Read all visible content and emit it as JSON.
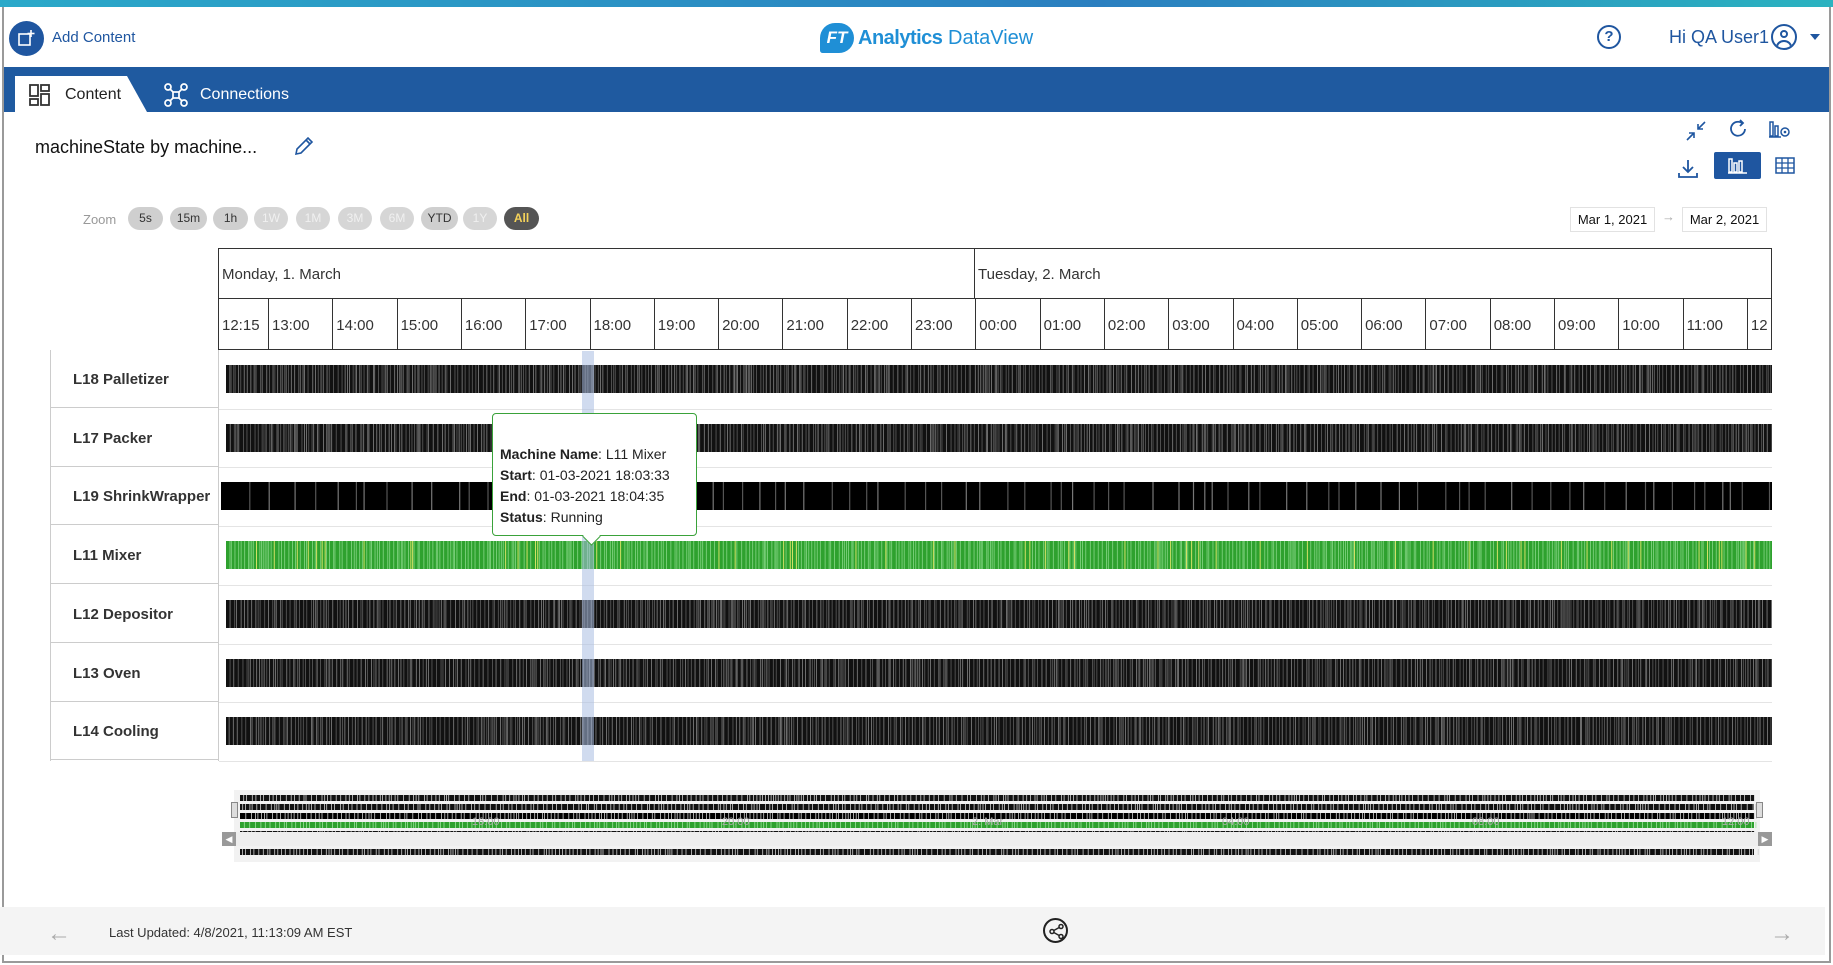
{
  "header": {
    "add_content_label": "Add Content",
    "logo_brand": "FT",
    "logo_product": "Analytics",
    "logo_suffix": "DataView",
    "greeting": "Hi QA User1",
    "icons": [
      "add-content-icon",
      "help-icon",
      "user-icon",
      "chevron-down-icon"
    ]
  },
  "nav": {
    "tabs": [
      {
        "label": "Content",
        "active": true,
        "icon": "grid-icon"
      },
      {
        "label": "Connections",
        "active": false,
        "icon": "connections-icon"
      }
    ]
  },
  "visualization": {
    "title": "machineState by machine...",
    "toolbar_icons": [
      "collapse-icon",
      "refresh-icon",
      "chart-settings-icon",
      "download-icon",
      "chart-view-icon",
      "table-view-icon"
    ]
  },
  "zoom": {
    "label": "Zoom",
    "options": [
      {
        "label": "5s",
        "enabled": true,
        "selected": false
      },
      {
        "label": "15m",
        "enabled": true,
        "selected": false
      },
      {
        "label": "1h",
        "enabled": true,
        "selected": false
      },
      {
        "label": "1W",
        "enabled": false,
        "selected": false
      },
      {
        "label": "1M",
        "enabled": false,
        "selected": false
      },
      {
        "label": "3M",
        "enabled": false,
        "selected": false
      },
      {
        "label": "6M",
        "enabled": false,
        "selected": false
      },
      {
        "label": "YTD",
        "enabled": true,
        "selected": false
      },
      {
        "label": "1Y",
        "enabled": false,
        "selected": false
      },
      {
        "label": "All",
        "enabled": true,
        "selected": true
      }
    ],
    "range_from": "Mar 1, 2021",
    "range_separator": "→",
    "range_to": "Mar 2, 2021"
  },
  "chart_data": {
    "type": "timeline",
    "days": [
      "Monday, 1. March",
      "Tuesday, 2. March"
    ],
    "hours": [
      "12:15",
      "13:00",
      "14:00",
      "15:00",
      "16:00",
      "17:00",
      "18:00",
      "19:00",
      "20:00",
      "21:00",
      "22:00",
      "23:00",
      "00:00",
      "01:00",
      "02:00",
      "03:00",
      "04:00",
      "05:00",
      "06:00",
      "07:00",
      "08:00",
      "09:00",
      "10:00",
      "11:00",
      "12"
    ],
    "rows": [
      {
        "name": "L18 Palletizer",
        "color": "#111111"
      },
      {
        "name": "L17 Packer",
        "color": "#111111"
      },
      {
        "name": "L19 ShrinkWrapper",
        "color": "#000000"
      },
      {
        "name": "L11 Mixer",
        "color": "#2ea12e"
      },
      {
        "name": "L12 Depositor",
        "color": "#111111"
      },
      {
        "name": "L13 Oven",
        "color": "#111111"
      },
      {
        "name": "L14 Cooling",
        "color": "#111111"
      }
    ],
    "tooltip": {
      "machine_label": "Machine Name",
      "machine_value": "L11 Mixer",
      "start_label": "Start",
      "start_value": "01-03-2021 18:03:33",
      "end_label": "End",
      "end_value": "01-03-2021 18:04:35",
      "status_label": "Status",
      "status_value": "Running"
    },
    "navigator_ticks": [
      "16:00",
      "20:00",
      "2. Mar",
      "04:00",
      "08:00",
      "12:00"
    ]
  },
  "footer": {
    "last_updated": "Last Updated: 4/8/2021, 11:13:09 AM EST",
    "icons": [
      "arrow-left-icon",
      "share-icon",
      "arrow-right-icon"
    ]
  }
}
